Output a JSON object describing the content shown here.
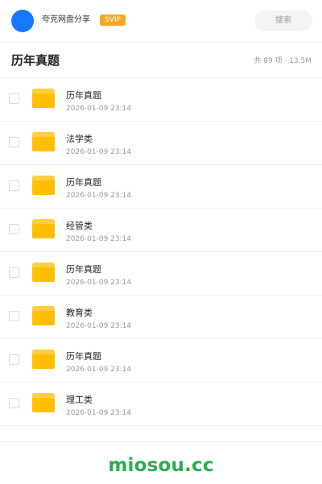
{
  "header": {
    "app_name": "夸克网盘分享",
    "badge": "SVIP",
    "search_placeholder": "搜索",
    "avatar_color": "#1677ff",
    "badge_color": "#f5a623"
  },
  "title_bar": {
    "title": "历年真题",
    "stats": "共 89 项 · 13.5M"
  },
  "items": [
    {
      "name": "历年真题",
      "date": "2026-01-09 23:14",
      "icon": "folder-icon"
    },
    {
      "name": "法学类",
      "date": "2026-01-09 23:14",
      "icon": "folder-icon"
    },
    {
      "name": "历年真题",
      "date": "2026-01-09 23:14",
      "icon": "folder-icon"
    },
    {
      "name": "经管类",
      "date": "2026-01-09 23:14",
      "icon": "folder-icon"
    },
    {
      "name": "历年真题",
      "date": "2026-01-09 23:14",
      "icon": "folder-icon"
    },
    {
      "name": "教育类",
      "date": "2026-01-09 23:14",
      "icon": "folder-icon"
    },
    {
      "name": "历年真题",
      "date": "2026-01-09 23:14",
      "icon": "folder-icon"
    },
    {
      "name": "理工类",
      "date": "2026-01-09 23:14",
      "icon": "folder-icon"
    }
  ],
  "footer": {
    "watermark": "miosou.cc",
    "watermark_color": "#2aad4b"
  },
  "colors": {
    "folder": "#ffbf00",
    "accent": "#1677ff"
  }
}
